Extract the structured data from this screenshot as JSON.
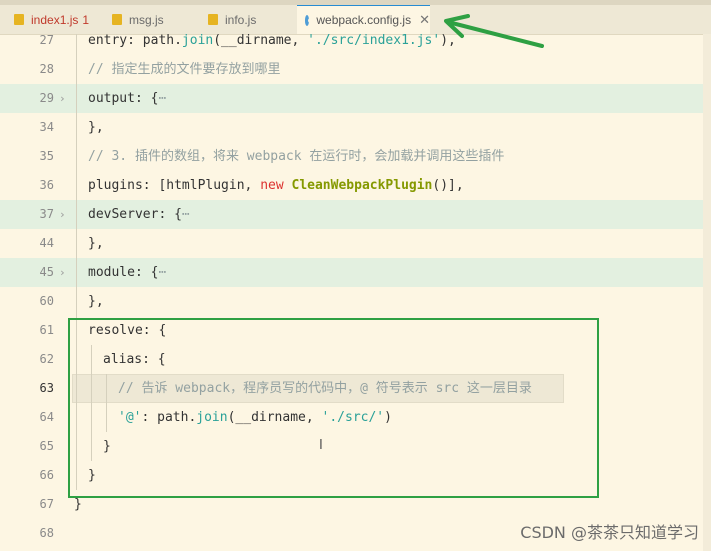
{
  "tabs": [
    {
      "label": "index1.js",
      "count": "1"
    },
    {
      "label": "msg.js"
    },
    {
      "label": "info.js"
    },
    {
      "label": "webpack.config.js",
      "close": "✕"
    }
  ],
  "lines": [
    {
      "num": "27",
      "t": [
        "entry: path.",
        "join",
        "(__dirname, ",
        "'./src/index1.js'",
        "),"
      ]
    },
    {
      "num": "28",
      "t": [
        "// 指定生成的文件要存放到哪里"
      ]
    },
    {
      "num": "29",
      "fold": "›",
      "t": [
        "output: {",
        "⋯"
      ]
    },
    {
      "num": "34",
      "t": [
        "},"
      ]
    },
    {
      "num": "35",
      "t": [
        "// 3. 插件的数组，将来 webpack 在运行时，会加载并调用这些插件"
      ]
    },
    {
      "num": "36",
      "t": [
        "plugins: [htmlPlugin, ",
        "new",
        " ",
        "CleanWebpackPlugin",
        "()],"
      ]
    },
    {
      "num": "37",
      "fold": "›",
      "t": [
        "devServer: {",
        "⋯"
      ]
    },
    {
      "num": "44",
      "t": [
        "},"
      ]
    },
    {
      "num": "45",
      "fold": "›",
      "t": [
        "module: {",
        "⋯"
      ]
    },
    {
      "num": "60",
      "t": [
        "},"
      ]
    },
    {
      "num": "61",
      "t": [
        "resolve: {"
      ]
    },
    {
      "num": "62",
      "t": [
        "alias: {"
      ]
    },
    {
      "num": "63",
      "t": [
        "// 告诉 webpack，程序员写的代码中，@ 符号表示 src 这一层目录"
      ]
    },
    {
      "num": "64",
      "t": [
        "'@'",
        ": path.",
        "join",
        "(__dirname, ",
        "'./src/'",
        ")"
      ]
    },
    {
      "num": "65",
      "t": [
        "}"
      ]
    },
    {
      "num": "66",
      "t": [
        "}"
      ]
    },
    {
      "num": "67",
      "t": [
        "}"
      ]
    },
    {
      "num": "68",
      "t": [
        ""
      ]
    }
  ],
  "cursor_glyph": "I",
  "watermark": "CSDN @茶茶只知道学习"
}
